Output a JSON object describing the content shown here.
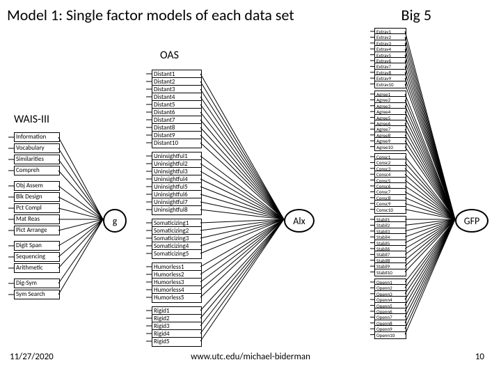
{
  "title": "Model 1:  Single factor models of each data set",
  "titleRight": "Big 5",
  "labels": {
    "wais": "WAIS-III",
    "oas": "OAS"
  },
  "latents": {
    "g": "g",
    "alx": "Alx",
    "gfp": "GFP"
  },
  "footer": {
    "date": "11/27/2020",
    "url": "www.utc.edu/michael-biderman",
    "page": "10"
  },
  "wais": [
    "Information",
    "Vocabulary",
    "Similarities",
    "Compreh",
    "Obj Assem",
    "Blk Design",
    "Pct Compl",
    "Mat Reas",
    "Pict Arrange",
    "Digit Span",
    "Sequencing",
    "Arithmetic",
    "Dig-Sym",
    "Sym Search"
  ],
  "oas": [
    "Distant1",
    "Distant2",
    "Distant3",
    "Distant4",
    "Distant5",
    "Distant6",
    "Distant7",
    "Distant8",
    "Distant9",
    "Distant10",
    "Uninsightful1",
    "Uninsightful2",
    "Uninsightful3",
    "Uninsightful4",
    "Uninsightful5",
    "Uninsightful6",
    "Uninsightful7",
    "Uninsightful8",
    "Somaticizing1",
    "Somaticizing2",
    "Somaticizing3",
    "Somaticizing4",
    "Somaticizing5",
    "Humorless1",
    "Humorless2",
    "Humorless3",
    "Humorless4",
    "Humorless5",
    "Rigid1",
    "Rigid2",
    "Rigid3",
    "Rigid4",
    "Rigid5"
  ],
  "oas_gaps": [
    10,
    18,
    23,
    28
  ],
  "big5": [
    "Extrav1",
    "Extrav2",
    "Extrav3",
    "Extrav4",
    "Extrav5",
    "Extrav6",
    "Extrav7",
    "Extrav8",
    "Extrav9",
    "Extrav10",
    "Agree1",
    "Agree2",
    "Agree3",
    "Agree4",
    "Agree5",
    "Agree6",
    "Agree7",
    "Agree8",
    "Agree9",
    "Agree10",
    "Consc1",
    "Consc2",
    "Consc3",
    "Consc4",
    "Consc5",
    "Consc6",
    "Consc7",
    "Consc8",
    "Consc9",
    "Consc10",
    "Stabil1",
    "Stabil2",
    "Stabil3",
    "Stabil4",
    "Stabil5",
    "Stabil6",
    "Stabil7",
    "Stabil8",
    "Stabil9",
    "Stabil10",
    "Openn1",
    "Openn2",
    "Openn3",
    "Openn4",
    "Openn5",
    "Openn6",
    "Openn7",
    "Openn8",
    "Openn9",
    "Openn10"
  ],
  "big5_gaps": [
    10,
    20,
    30,
    40
  ]
}
